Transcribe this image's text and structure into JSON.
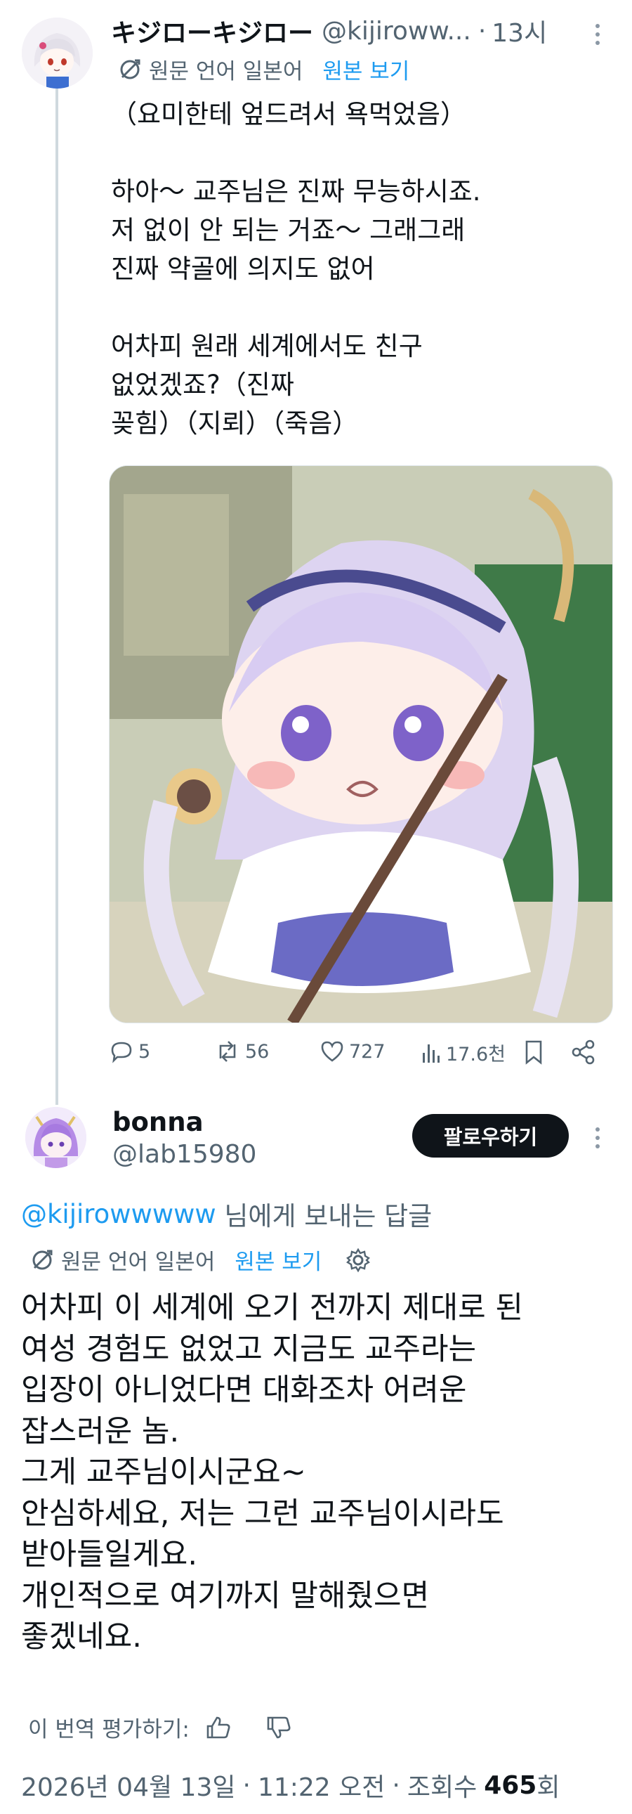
{
  "tweet1": {
    "display_name": "キジローキジロー",
    "handle": "@kijiroww...",
    "separator": "·",
    "time": "13시",
    "translate_label": "원문 언어 일본어",
    "view_original": "원본 보기",
    "text": "（요미한테 엎드려서 욕먹었음）\n\n하아～ 교주님은 진짜 무능하시죠.\n저 없이 안 되는 거죠～ 그래그래\n진짜 약골에 의지도 없어\n\n어차피 원래 세계에서도 친구\n없었겠죠?（진짜\n꽂힘）（지뢰）（죽음）",
    "stats": {
      "replies": "5",
      "retweets": "56",
      "likes": "727",
      "views": "17.6천"
    },
    "icons": [
      "reply-icon",
      "retweet-icon",
      "like-icon",
      "views-icon",
      "bookmark-icon",
      "share-icon"
    ]
  },
  "tweet2": {
    "display_name": "bonna",
    "handle": "@lab15980",
    "follow_label": "팔로우하기",
    "reply_to_handle": "@kijirowwwww",
    "reply_to_suffix": " 님에게 보내는 답글",
    "translate_label": "원문 언어 일본어",
    "view_original": "원본 보기",
    "text": "어차피 이 세계에 오기 전까지 제대로 된\n여성 경험도 없었고 지금도 교주라는\n입장이 아니었다면 대화조차 어려운\n잡스러운 놈.\n그게 교주님이시군요~\n안심하세요, 저는 그런 교주님이시라도\n받아들일게요.\n개인적으로 여기까지 말해줬으면\n좋겠네요.",
    "rate_label": "이 번역 평가하기:",
    "date": "2026년 04월 13일",
    "time": "11:22 오전",
    "views_label": "조회수",
    "views_count": "465",
    "views_unit": "회"
  },
  "colors": {
    "accent": "#1d9bf0",
    "text": "#0f1419",
    "muted": "#536471",
    "thread_line": "#cfd9de"
  }
}
